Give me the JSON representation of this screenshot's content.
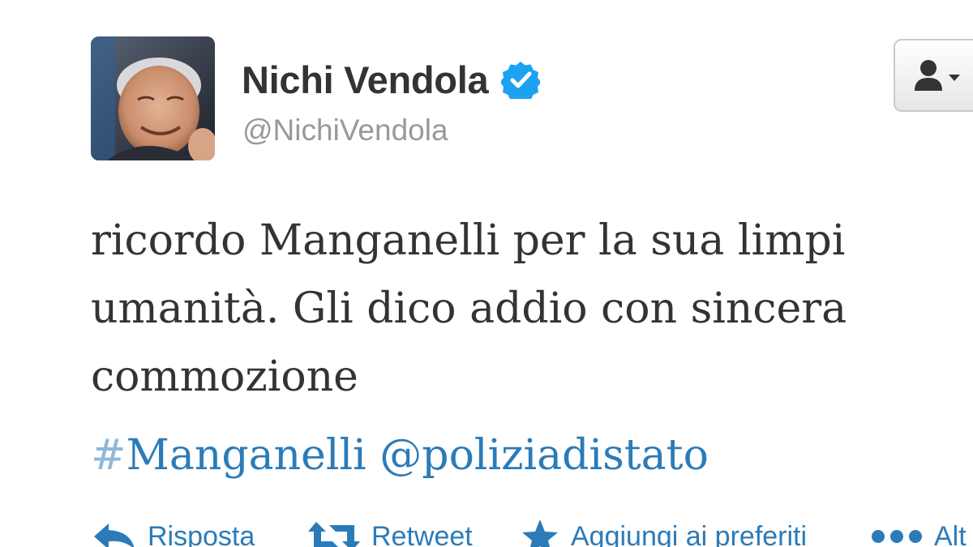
{
  "profile": {
    "display_name": "Nichi Vendola",
    "handle": "@NichiVendola",
    "verified": true
  },
  "tweet": {
    "lines": [
      "ricordo  Manganelli per la sua limpi",
      "umanità. Gli dico addio con sincera",
      "commozione"
    ],
    "hashtag": {
      "symbol": "#",
      "text": "Manganelli"
    },
    "mention": "@poliziadistato"
  },
  "actions": {
    "reply": "Risposta",
    "retweet": "Retweet",
    "favorite": "Aggiungi ai preferiti",
    "more": "Alt"
  },
  "colors": {
    "link": "#2b7bb9",
    "verified": "#1da1f2",
    "text": "#333333",
    "handle": "#999999"
  },
  "icons": {
    "verified": "verified-badge-icon",
    "follow": "user-icon",
    "reply": "reply-arrow-icon",
    "retweet": "retweet-icon",
    "favorite": "star-icon",
    "more": "ellipsis-icon"
  }
}
